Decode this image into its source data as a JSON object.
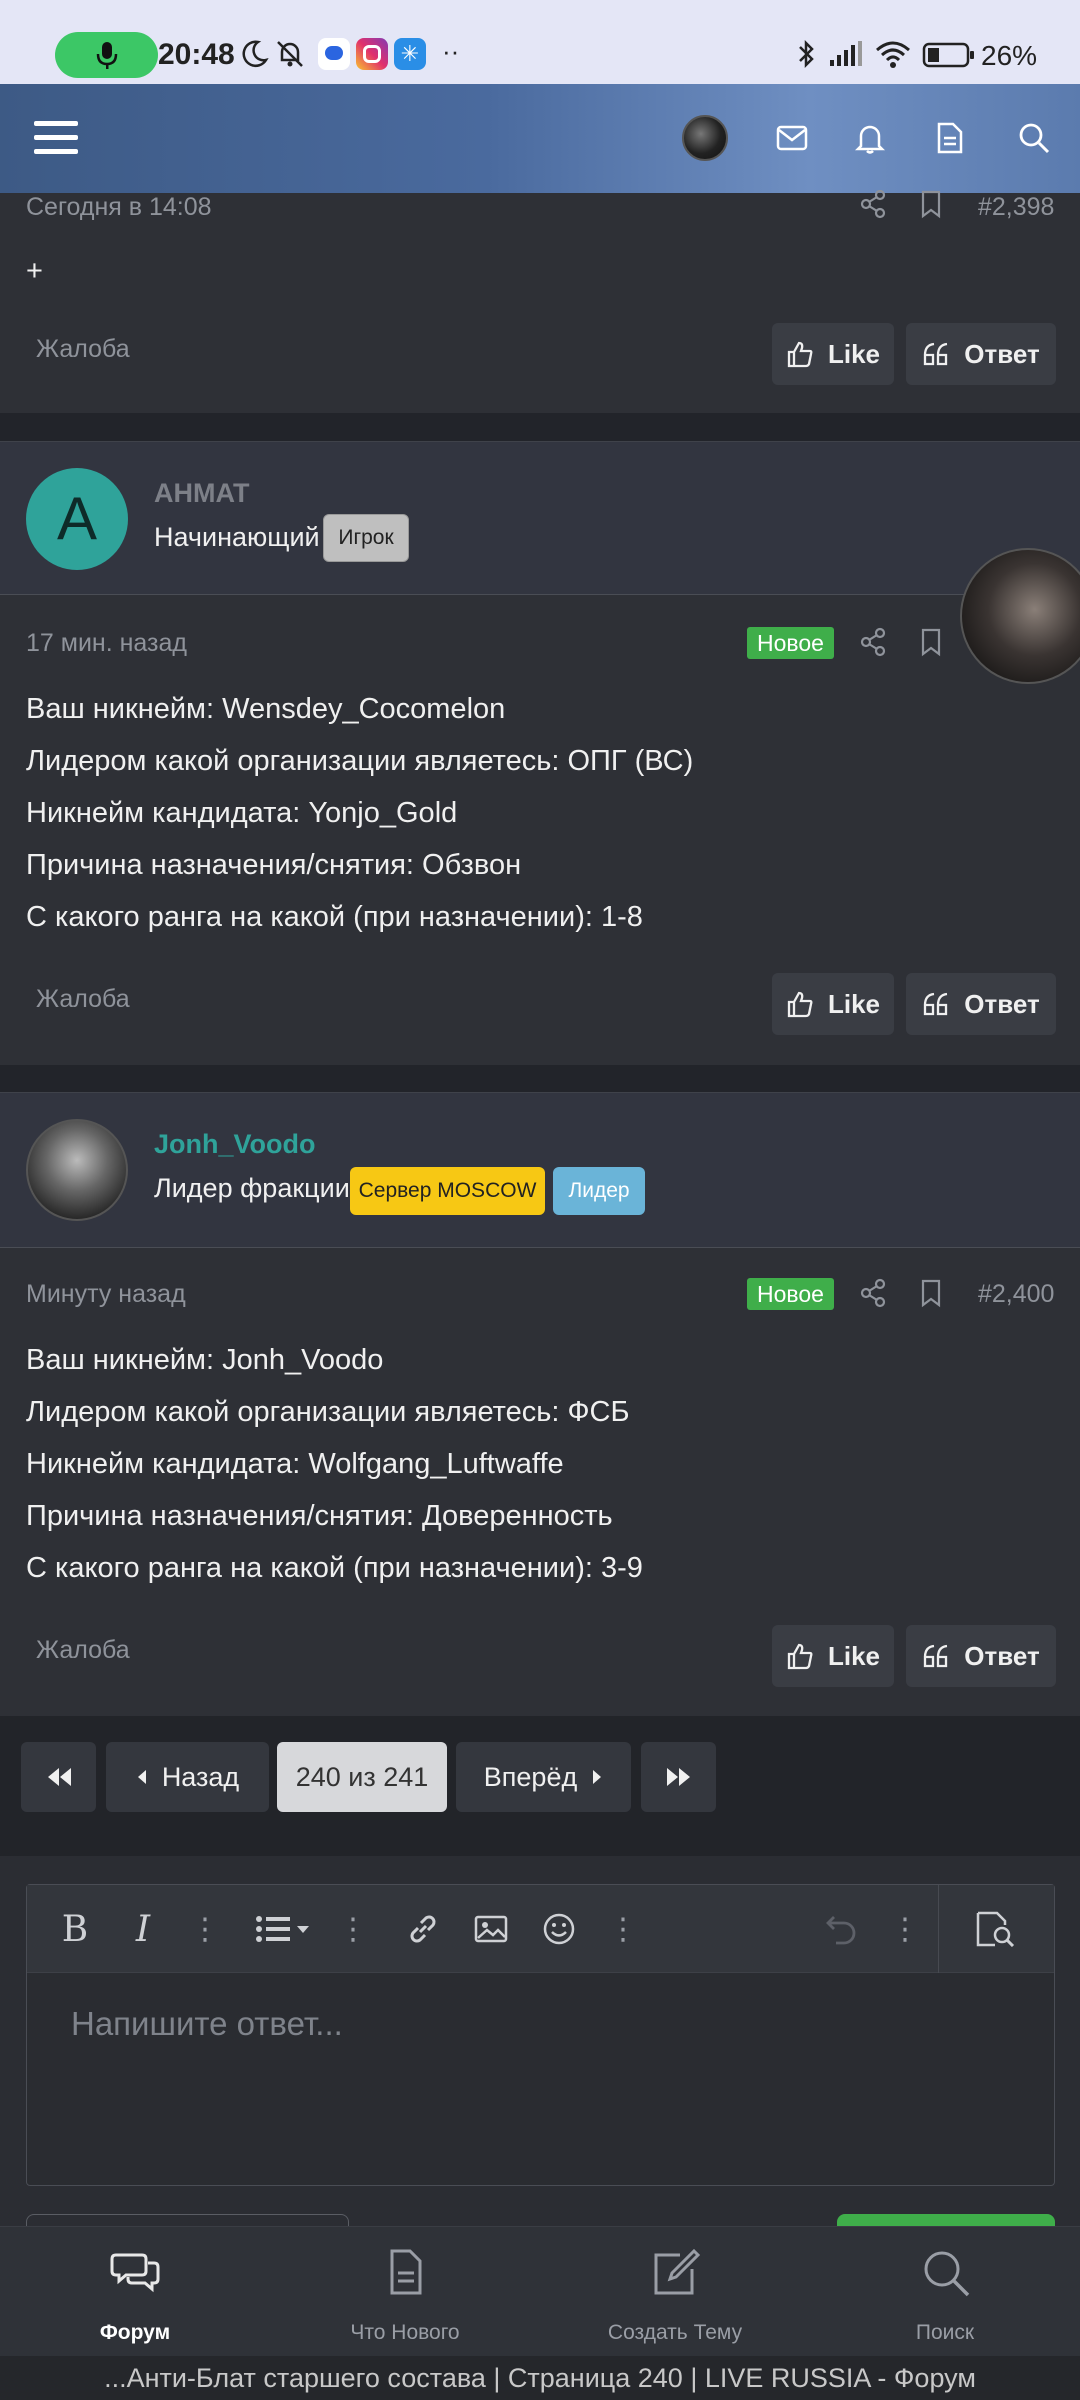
{
  "status_bar": {
    "time": "20:48",
    "battery_percent": "26%",
    "icons": [
      "mic-icon",
      "moon-icon",
      "bell-off-icon",
      "chat-app-icon",
      "instagram-icon",
      "app-star-icon",
      "more-dots-icon",
      "bluetooth-icon",
      "signal-icon",
      "wifi-icon",
      "battery-icon"
    ]
  },
  "top_nav": {
    "icons": [
      "menu-icon",
      "avatar",
      "mail-icon",
      "bell-icon",
      "document-icon",
      "search-icon"
    ]
  },
  "post_prev": {
    "date": "Сегодня в 14:08",
    "number": "#2,398",
    "body": "+",
    "report": "Жалоба",
    "like_label": "Like",
    "reply_label": "Ответ"
  },
  "post_ahmat": {
    "author": "AHMAT",
    "avatar_letter": "A",
    "user_title": "Начинающий",
    "badges": [
      {
        "label": "Игрок"
      }
    ],
    "date": "17 мин. назад",
    "new_label": "Новое",
    "lines": [
      "Ваш никнейм: Wensdey_Cocomelon",
      "Лидером какой организации являетесь: ОПГ (ВС)",
      "Никнейм кандидата: Yonjo_Gold",
      "Причина назначения/снятия: Обзвон",
      "С какого ранга на какой (при назначении): 1-8"
    ],
    "report": "Жалоба",
    "like_label": "Like",
    "reply_label": "Ответ"
  },
  "post_voodo": {
    "author": "Jonh_Voodo",
    "user_title": "Лидер фракции",
    "badges": [
      {
        "label": "Сервер MOSCOW"
      },
      {
        "label": "Лидер"
      }
    ],
    "date": "Минуту назад",
    "new_label": "Новое",
    "number": "#2,400",
    "lines": [
      "Ваш никнейм: Jonh_Voodo",
      "Лидером какой организации являетесь: ФСБ",
      "Никнейм кандидата: Wolfgang_Luftwaffe",
      "Причина назначения/снятия: Доверенность",
      "С какого ранга на какой (при назначении): 3-9"
    ],
    "report": "Жалоба",
    "like_label": "Like",
    "reply_label": "Ответ"
  },
  "pagination": {
    "prev_label": "Назад",
    "current": "240 из 241",
    "next_label": "Вперёд"
  },
  "editor": {
    "placeholder": "Напишите ответ..."
  },
  "bottom_nav": {
    "items": [
      {
        "label": "Форум",
        "icon": "forum-icon",
        "active": true
      },
      {
        "label": "Что Нового",
        "icon": "whats-new-icon"
      },
      {
        "label": "Создать Тему",
        "icon": "create-topic-icon"
      },
      {
        "label": "Поиск",
        "icon": "search-icon"
      }
    ]
  },
  "page_title": "...Анти-Блат старшего состава | Страница 240 | LIVE RUSSIA - Форум",
  "colors": {
    "accent_green": "#3fae4a",
    "username_teal": "#2fa39a",
    "badge_yellow": "#f7c814",
    "badge_blue": "#6ab4d8",
    "badge_gray": "#bfbfbf"
  }
}
